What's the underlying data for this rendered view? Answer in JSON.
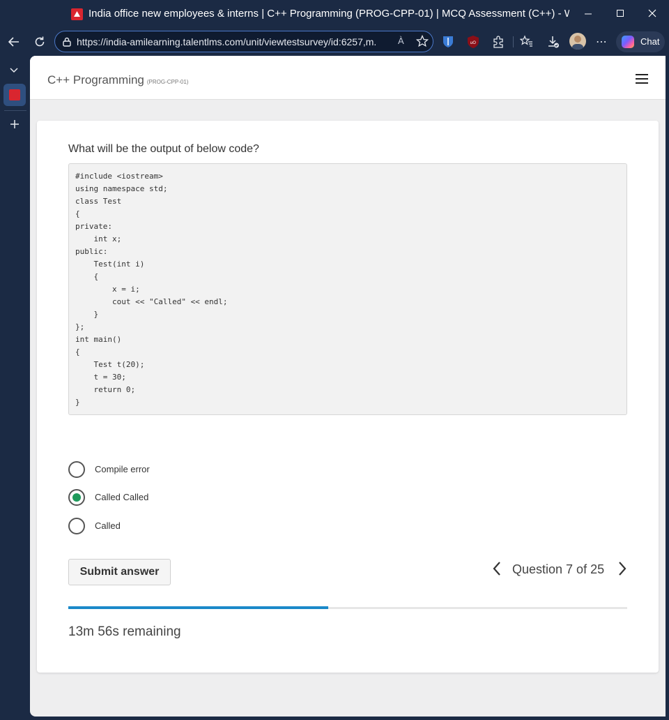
{
  "browser": {
    "tab_title": "India office new employees & interns | C++ Programming (PROG-CPP-01) | MCQ Assessment (C++) - Week...",
    "url": "https://india-amilearning.talentlms.com/unit/viewtestsurvey/id:6257,m...",
    "read_aloud": "À",
    "chat_label": "Chat"
  },
  "page": {
    "course_title": "C++ Programming",
    "course_code": "(PROG-CPP-01)"
  },
  "quiz": {
    "question": "What will be the output of below code?",
    "code": "#include <iostream>\nusing namespace std;\nclass Test\n{\nprivate:\n    int x;\npublic:\n    Test(int i)\n    {\n        x = i;\n        cout << \"Called\" << endl;\n    }\n};\nint main()\n{\n    Test t(20);\n    t = 30;\n    return 0;\n}",
    "options": [
      {
        "label": "Compile error",
        "selected": false
      },
      {
        "label": "Called Called",
        "selected": true
      },
      {
        "label": "Called",
        "selected": false
      }
    ],
    "submit_label": "Submit answer",
    "question_counter": "Question 7 of 25",
    "progress_fraction": 0.465,
    "time_remaining": "13m 56s remaining"
  },
  "colors": {
    "accent": "#1b89c9",
    "selected_radio": "#1e9a5b",
    "brand_red": "#d9262f",
    "chrome_bg": "#1b2a44"
  }
}
